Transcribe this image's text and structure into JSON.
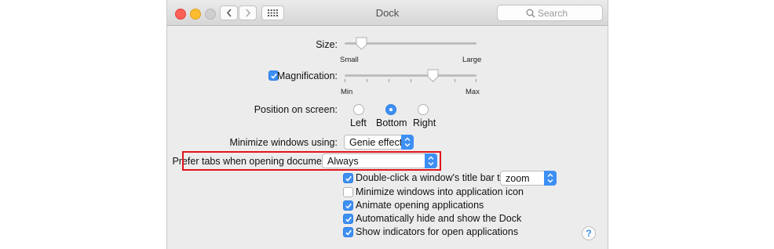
{
  "window": {
    "title": "Dock",
    "search_placeholder": "Search",
    "traffic_lights": {
      "close": "#fc5f57",
      "minimize": "#fdbc2e",
      "zoom": "#cfcfcf"
    },
    "nav": {
      "back": "back-icon",
      "forward": "forward-icon",
      "grid": "show-all-icon"
    }
  },
  "size": {
    "label": "Size:",
    "min_label": "Small",
    "max_label": "Large",
    "value": 0.12
  },
  "magnification": {
    "label": "Magnification:",
    "checked": true,
    "min_label": "Min",
    "max_label": "Max",
    "value": 0.67
  },
  "position": {
    "label": "Position on screen:",
    "options": [
      {
        "label": "Left",
        "selected": false
      },
      {
        "label": "Bottom",
        "selected": true
      },
      {
        "label": "Right",
        "selected": false
      }
    ]
  },
  "minimize": {
    "label": "Minimize windows using:",
    "value": "Genie effect"
  },
  "prefer_tabs": {
    "label": "Prefer tabs when opening documents:",
    "value": "Always"
  },
  "double_click": {
    "label": "Double-click a window's title bar to",
    "checked": true,
    "value": "zoom"
  },
  "checkboxes": [
    {
      "label": "Minimize windows into application icon",
      "checked": false
    },
    {
      "label": "Animate opening applications",
      "checked": true
    },
    {
      "label": "Automatically hide and show the Dock",
      "checked": true
    },
    {
      "label": "Show indicators for open applications",
      "checked": true
    }
  ],
  "help": "?",
  "colors": {
    "accent": "#3d8ff4",
    "highlight": "#e0151b"
  }
}
